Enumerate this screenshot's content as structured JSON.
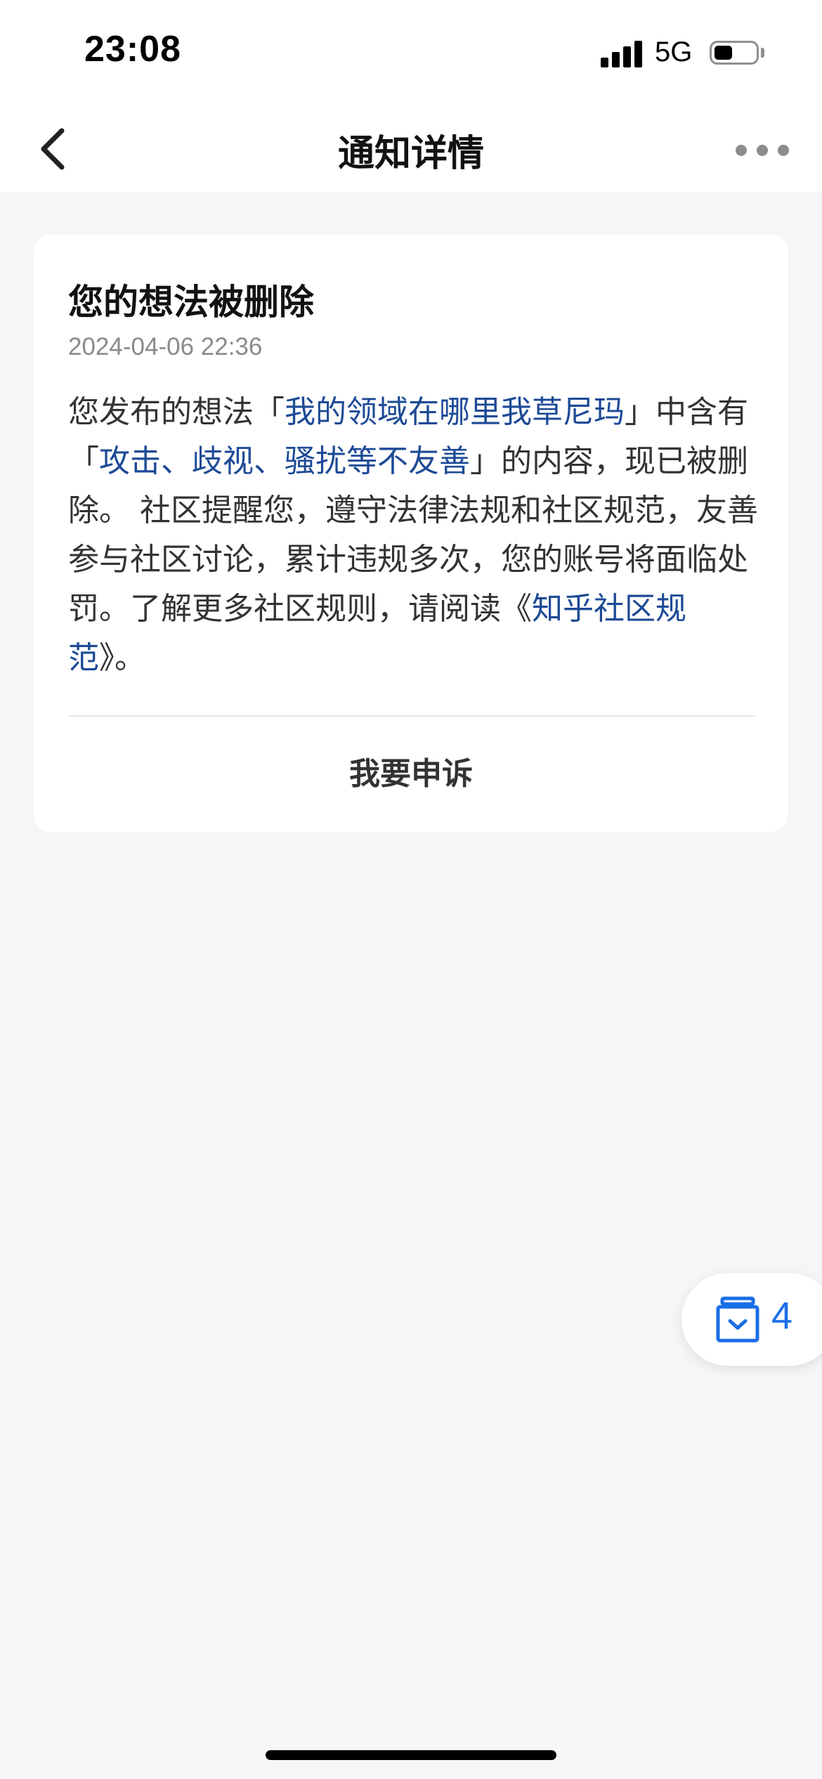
{
  "status_bar": {
    "time": "23:08",
    "network": "5G",
    "battery_level": 0.45
  },
  "nav": {
    "title": "通知详情",
    "back_icon": "chevron-left-icon",
    "more_icon": "ellipsis-icon"
  },
  "notification": {
    "title": "您的想法被删除",
    "time": "2024-04-06 22:36",
    "body": {
      "p1": "您发布的想法「",
      "post_title": "我的领域在哪里我草尼玛",
      "p2": "」中含有「",
      "violation": "攻击、歧视、骚扰等不友善",
      "p3": "」的内容，现已被删除。 社区提醒您，遵守法律法规和社区规范，友善参与社区讨论，累计违规多次，您的账号将面临处罚。了解更多社区规则，请阅读《",
      "rules_link": "知乎社区规范",
      "p4": "》。"
    },
    "appeal_label": "我要申诉"
  },
  "float_badge": {
    "icon": "inbox-check-icon",
    "count": "4"
  },
  "colors": {
    "link": "#1d4a96",
    "accent": "#1a6ee6",
    "background": "#f6f6f8"
  }
}
